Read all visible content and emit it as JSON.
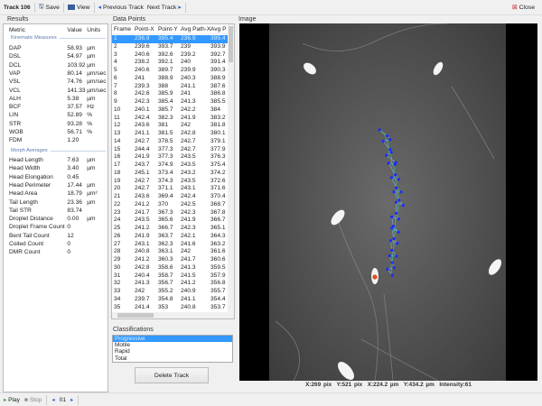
{
  "toolbar": {
    "title": "Track 106",
    "save": "Save",
    "view": "View",
    "prev": "Previous Track",
    "next": "Next Track",
    "close": "Close"
  },
  "panels": {
    "results": "Results",
    "data_points": "Data Points",
    "image": "Image",
    "classifications": "Classifications"
  },
  "results": {
    "headers": [
      "Metric",
      "Value",
      "Units"
    ],
    "kinematic_label": "Kinematic Measures",
    "kinematic": [
      [
        "DAP",
        "58.93",
        "µm"
      ],
      [
        "DSL",
        "54.97",
        "µm"
      ],
      [
        "DCL",
        "103.92",
        "µm"
      ],
      [
        "VAP",
        "80.14",
        "µm/sec"
      ],
      [
        "VSL",
        "74.76",
        "µm/sec"
      ],
      [
        "VCL",
        "141.33",
        "µm/sec"
      ],
      [
        "ALH",
        "5.38",
        "µm"
      ],
      [
        "BCF",
        "37.57",
        "Hz"
      ],
      [
        "LIN",
        "52.89",
        "%"
      ],
      [
        "STR",
        "93.28",
        "%"
      ],
      [
        "WOB",
        "56.71",
        "%"
      ],
      [
        "FDM",
        "1.20",
        ""
      ]
    ],
    "morph_label": "Morph Averages",
    "morph": [
      [
        "Head Length",
        "7.63",
        "µm"
      ],
      [
        "Head Width",
        "3.40",
        "µm"
      ],
      [
        "Head Elongation",
        "0.45",
        ""
      ],
      [
        "Head Perimeter",
        "17.44",
        "µm"
      ],
      [
        "Head Area",
        "18.79",
        "µm²"
      ],
      [
        "Tail Length",
        "23.36",
        "µm"
      ],
      [
        "Tail STR",
        "83.74",
        ""
      ],
      [
        "Droplet Distance",
        "0.00",
        "µm"
      ],
      [
        "Droplet Frame Count",
        "0",
        ""
      ],
      [
        "Bent Tail Count",
        "12",
        ""
      ],
      [
        "Coiled Count",
        "0",
        ""
      ],
      [
        "DMR Count",
        "0",
        ""
      ]
    ]
  },
  "data_points": {
    "headers": [
      "Frame",
      "Point-X",
      "Point-Y",
      "Avg Path-X",
      "Avg P"
    ],
    "rows": [
      [
        "1",
        "236.9",
        "395.4",
        "236.9",
        "395.4"
      ],
      [
        "2",
        "239.6",
        "393.7",
        "239",
        "393.9"
      ],
      [
        "3",
        "240.6",
        "392.6",
        "239.2",
        "392.7"
      ],
      [
        "4",
        "238.2",
        "392.1",
        "240",
        "391.4"
      ],
      [
        "5",
        "240.6",
        "389.7",
        "239.9",
        "390.3"
      ],
      [
        "6",
        "241",
        "388.9",
        "240.3",
        "388.9"
      ],
      [
        "7",
        "239.3",
        "388",
        "241.1",
        "387.6"
      ],
      [
        "8",
        "242.6",
        "385.9",
        "241",
        "386.8"
      ],
      [
        "9",
        "242.3",
        "385.4",
        "241.3",
        "385.5"
      ],
      [
        "10",
        "240.1",
        "385.7",
        "242.2",
        "384"
      ],
      [
        "11",
        "242.4",
        "382.3",
        "241.9",
        "383.2"
      ],
      [
        "12",
        "243.6",
        "381",
        "242",
        "381.8"
      ],
      [
        "13",
        "241.1",
        "381.5",
        "242.8",
        "380.1"
      ],
      [
        "14",
        "242.7",
        "378.5",
        "242.7",
        "379.1"
      ],
      [
        "15",
        "244.4",
        "377.3",
        "242.7",
        "377.9"
      ],
      [
        "16",
        "241.9",
        "377.3",
        "243.5",
        "376.3"
      ],
      [
        "17",
        "243.7",
        "374.9",
        "243.5",
        "375.4"
      ],
      [
        "18",
        "245.1",
        "373.4",
        "243.2",
        "374.2"
      ],
      [
        "19",
        "242.7",
        "374.3",
        "243.5",
        "372.6"
      ],
      [
        "20",
        "242.7",
        "371.1",
        "243.1",
        "371.6"
      ],
      [
        "21",
        "243.6",
        "369.4",
        "242.4",
        "370.4"
      ],
      [
        "22",
        "241.2",
        "370",
        "242.5",
        "368.7"
      ],
      [
        "23",
        "241.7",
        "367.3",
        "242.3",
        "367.8"
      ],
      [
        "24",
        "243.5",
        "365.6",
        "241.9",
        "366.7"
      ],
      [
        "25",
        "241.2",
        "366.7",
        "242.3",
        "365.1"
      ],
      [
        "26",
        "241.9",
        "363.7",
        "242.1",
        "364.3"
      ],
      [
        "27",
        "243.1",
        "362.3",
        "241.6",
        "363.2"
      ],
      [
        "28",
        "240.8",
        "363.1",
        "242",
        "361.6"
      ],
      [
        "29",
        "241.2",
        "360.3",
        "241.7",
        "360.6"
      ],
      [
        "30",
        "242.8",
        "358.6",
        "241.3",
        "359.5"
      ],
      [
        "31",
        "240.4",
        "358.7",
        "241.5",
        "357.9"
      ],
      [
        "32",
        "241.3",
        "356.7",
        "241.2",
        "356.8"
      ],
      [
        "33",
        "242",
        "355.2",
        "240.9",
        "355.7"
      ],
      [
        "34",
        "239.7",
        "354.8",
        "241.1",
        "354.4"
      ],
      [
        "35",
        "241.4",
        "353",
        "240.8",
        "353.7"
      ]
    ]
  },
  "classifications": {
    "items": [
      "Progressive",
      "Motile",
      "Rapid",
      "Total"
    ],
    "selected": 0
  },
  "delete_track": "Delete Track",
  "status": {
    "x_pix": "X:269 pix",
    "y_pix": "Y:521 pix",
    "x_um": "X:224.2 µm",
    "y_um": "Y:434.2 µm",
    "intensity": "Intensity:61"
  },
  "bottom": {
    "play": "Play",
    "stop": "Stop",
    "frame": "01"
  },
  "colors": {
    "selection": "#3399ff",
    "track_point": "#1a2cff",
    "head_marker": "#e0501e"
  }
}
